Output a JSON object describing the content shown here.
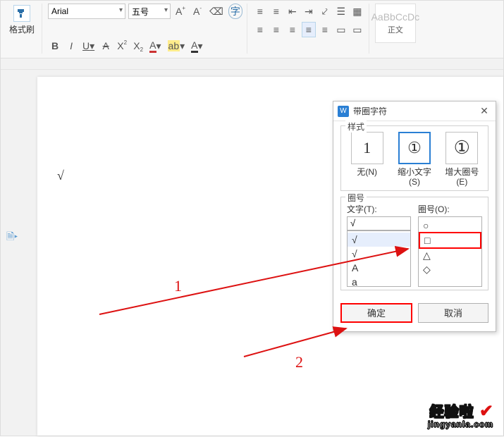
{
  "ribbon": {
    "format_brush": {
      "label": "格式刷"
    },
    "font_name": "Arial",
    "font_size": "五号",
    "btns_row1": {
      "grow_font": "A",
      "grow_sup": "+",
      "shrink_font": "A",
      "shrink_sup": "-",
      "clear_fmt": "⌫",
      "enclosed": "字"
    },
    "btns_row2": {
      "bold": "B",
      "italic": "I",
      "underline": "U",
      "strike": "A",
      "super": "X",
      "super_sup": "2",
      "sub": "X",
      "sub_sup": "2",
      "font_color": "A",
      "highlight": "ab",
      "text_color": "A"
    },
    "para_row1": {
      "bullets": "≡",
      "numbering": "≡",
      "outdent": "⇤",
      "indent": "⇥",
      "tabs": "⤦",
      "compare": "☰",
      "cell": "▦"
    },
    "para_row2": {
      "align_l": "≡",
      "align_c": "≡",
      "align_r": "≡",
      "align_j": "≡",
      "line_sp": "≡",
      "shading": "▭",
      "borders": "▭"
    },
    "style_preview": "AaBbCcDc",
    "style_name": "正文"
  },
  "document": {
    "caret_glyph": "√",
    "gutter_icon": "🗎▸"
  },
  "dialog": {
    "title": "带圈字符",
    "section_style": "样式",
    "styles": [
      {
        "glyph": "1",
        "label": "无(N)"
      },
      {
        "glyph": "①",
        "label": "缩小文字(S)"
      },
      {
        "glyph": "①",
        "label": "增大圈号(E)"
      }
    ],
    "section_enclose": "圈号",
    "text_label": "文字(T):",
    "text_value": "√",
    "text_options": [
      "√",
      "√",
      "A",
      "a"
    ],
    "shape_label": "圈号(O):",
    "shape_options": [
      "○",
      "□",
      "△",
      "◇"
    ],
    "ok": "确定",
    "cancel": "取消"
  },
  "anno": {
    "one": "1",
    "two": "2"
  },
  "watermark": {
    "main": "经验啦",
    "check": "✔",
    "sub": "jingyanla.com"
  }
}
